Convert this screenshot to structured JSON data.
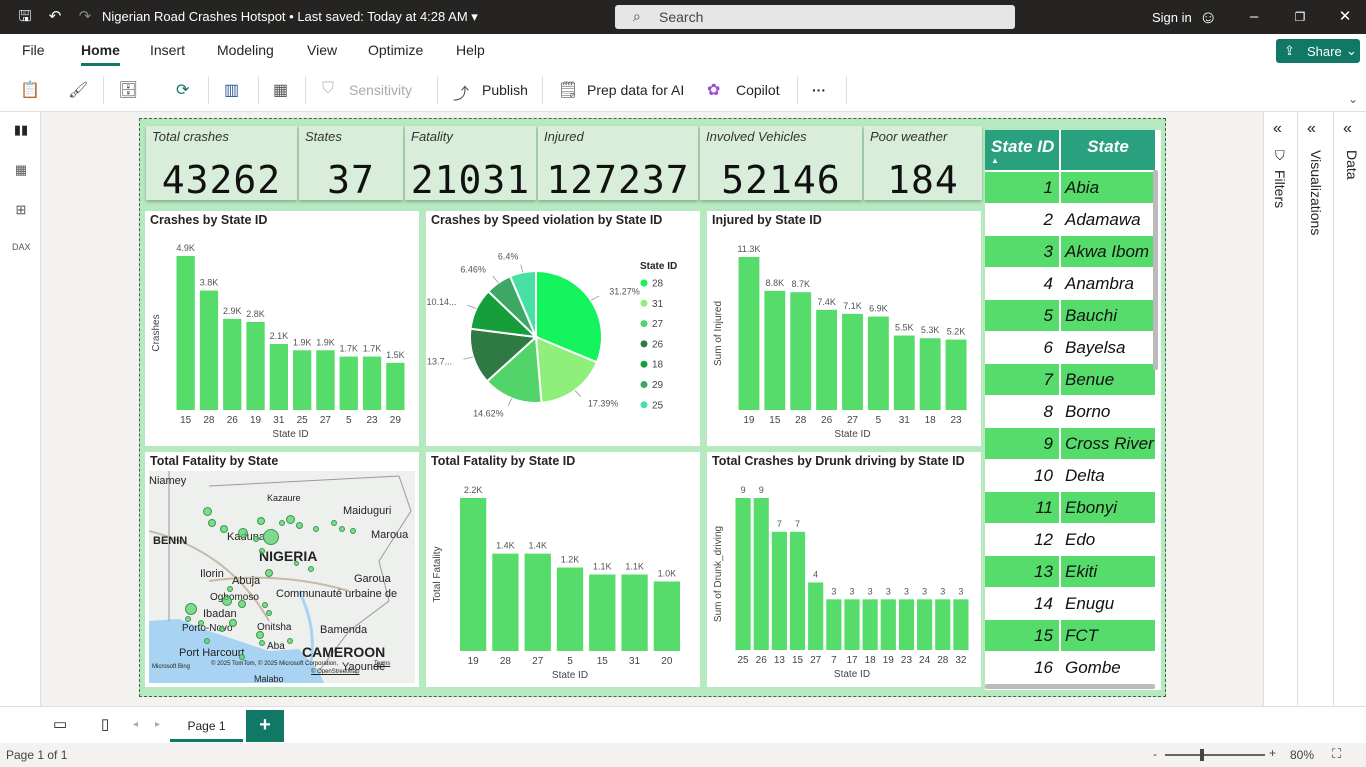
{
  "titlebar": {
    "doc_title": "Nigerian Road Crashes Hotspot",
    "saved": "Last saved: Today at 4:28 AM",
    "search_placeholder": "Search",
    "signin": "Sign in"
  },
  "menu": [
    "File",
    "Home",
    "Insert",
    "Modeling",
    "View",
    "Optimize",
    "Help"
  ],
  "share_label": "Share",
  "ribbon": {
    "sensitivity": "Sensitivity",
    "publish": "Publish",
    "prep": "Prep data for AI",
    "copilot": "Copilot",
    "more": "···"
  },
  "cards": [
    {
      "label": "Total crashes",
      "value": "43262"
    },
    {
      "label": "States",
      "value": "37"
    },
    {
      "label": "Fatality",
      "value": "21031"
    },
    {
      "label": "Injured",
      "value": "127237"
    },
    {
      "label": "Involved Vehicles",
      "value": "52146"
    },
    {
      "label": "Poor weather",
      "value": "184"
    }
  ],
  "charts": {
    "crashes_by_state": {
      "title": "Crashes by State ID",
      "ylabel": "Crashes",
      "xlabel": "State ID"
    },
    "pie": {
      "title": "Crashes by Speed violation by State ID",
      "legend_title": "State ID"
    },
    "injured": {
      "title": "Injured by State ID",
      "ylabel": "Sum of Injured",
      "xlabel": "State ID"
    },
    "map": {
      "title": "Total Fatality by State"
    },
    "fatality": {
      "title": "Total Fatality by State ID",
      "ylabel": "Total Fatality",
      "xlabel": "State ID"
    },
    "drunk": {
      "title": "Total Crashes by Drunk driving by State ID",
      "ylabel": "Sum of Drunk_driving",
      "xlabel": "State ID"
    }
  },
  "chart_data": [
    {
      "type": "bar",
      "title": "Crashes by State ID",
      "xlabel": "State ID",
      "ylabel": "Crashes",
      "categories": [
        "15",
        "28",
        "26",
        "19",
        "31",
        "25",
        "27",
        "5",
        "23",
        "29"
      ],
      "values": [
        4900,
        3800,
        2900,
        2800,
        2100,
        1900,
        1900,
        1700,
        1700,
        1500
      ],
      "labels": [
        "4.9K",
        "3.8K",
        "2.9K",
        "2.8K",
        "2.1K",
        "1.9K",
        "1.9K",
        "1.7K",
        "1.7K",
        "1.5K"
      ],
      "color": "#56dc6a"
    },
    {
      "type": "pie",
      "title": "Crashes by Speed violation by State ID",
      "categories": [
        "28",
        "31",
        "27",
        "26",
        "18",
        "29",
        "25"
      ],
      "values": [
        31.27,
        17.39,
        14.62,
        13.7,
        10.14,
        6.46,
        6.4
      ],
      "labels": [
        "31.27%",
        "17.39%",
        "14.62%",
        "13.7...",
        "10.14...",
        "6.46%",
        "6.4%"
      ],
      "colors": [
        "#12f35c",
        "#8ef07a",
        "#52d46a",
        "#2e7a42",
        "#159e3a",
        "#3da766",
        "#46e0a4"
      ]
    },
    {
      "type": "bar",
      "title": "Injured by State ID",
      "xlabel": "State ID",
      "ylabel": "Sum of Injured",
      "categories": [
        "19",
        "15",
        "28",
        "26",
        "27",
        "5",
        "31",
        "18",
        "23"
      ],
      "values": [
        11300,
        8800,
        8700,
        7400,
        7100,
        6900,
        5500,
        5300,
        5200
      ],
      "labels": [
        "11.3K",
        "8.8K",
        "8.7K",
        "7.4K",
        "7.1K",
        "6.9K",
        "5.5K",
        "5.3K",
        "5.2K"
      ],
      "color": "#56dc6a"
    },
    {
      "type": "bar",
      "title": "Total Fatality by State ID",
      "xlabel": "State ID",
      "ylabel": "Total Fatality",
      "categories": [
        "19",
        "28",
        "27",
        "5",
        "15",
        "31",
        "20"
      ],
      "values": [
        2200,
        1400,
        1400,
        1200,
        1100,
        1100,
        1000
      ],
      "labels": [
        "2.2K",
        "1.4K",
        "1.4K",
        "1.2K",
        "1.1K",
        "1.1K",
        "1.0K"
      ],
      "color": "#56dc6a"
    },
    {
      "type": "bar",
      "title": "Total Crashes by Drunk driving by State ID",
      "xlabel": "State ID",
      "ylabel": "Sum of Drunk_driving",
      "categories": [
        "25",
        "26",
        "13",
        "15",
        "27",
        "7",
        "17",
        "18",
        "19",
        "23",
        "24",
        "28",
        "32"
      ],
      "values": [
        9,
        9,
        7,
        7,
        4,
        3,
        3,
        3,
        3,
        3,
        3,
        3,
        3
      ],
      "labels": [
        "9",
        "9",
        "7",
        "7",
        "4",
        "3",
        "3",
        "3",
        "3",
        "3",
        "3",
        "3",
        "3"
      ],
      "color": "#56dc6a"
    }
  ],
  "map": {
    "labels": [
      "Niamey",
      "Kazaure",
      "Maiduguri",
      "BENIN",
      "Kaduna",
      "NIGERIA",
      "Maroua",
      "Ilorin",
      "Abuja",
      "Garoua",
      "Ogbomoso",
      "Communauté urbaine de",
      "Ibadan",
      "Porto-Novo",
      "Onitsha",
      "Bamenda",
      "CAMEROON",
      "Port Harcourt",
      "Aba",
      "Yaoundé",
      "Malabo"
    ],
    "credit": "© 2025 TomTom, © 2025 Microsoft Corporation,",
    "terms": "Terms",
    "osm": "© OpenStreetMap",
    "bing": "Microsoft Bing"
  },
  "table": {
    "headers": [
      "State ID",
      "State"
    ],
    "rows": [
      [
        "1",
        "Abia"
      ],
      [
        "2",
        "Adamawa"
      ],
      [
        "3",
        "Akwa Ibom"
      ],
      [
        "4",
        "Anambra"
      ],
      [
        "5",
        "Bauchi"
      ],
      [
        "6",
        "Bayelsa"
      ],
      [
        "7",
        "Benue"
      ],
      [
        "8",
        "Borno"
      ],
      [
        "9",
        "Cross River"
      ],
      [
        "10",
        "Delta"
      ],
      [
        "11",
        "Ebonyi"
      ],
      [
        "12",
        "Edo"
      ],
      [
        "13",
        "Ekiti"
      ],
      [
        "14",
        "Enugu"
      ],
      [
        "15",
        "FCT"
      ],
      [
        "16",
        "Gombe"
      ]
    ],
    "row_colors": [
      "#56dc6a",
      "#ffffff"
    ]
  },
  "panes": {
    "filters": "Filters",
    "visualizations": "Visualizations",
    "data": "Data"
  },
  "bottom": {
    "page_tab": "Page 1",
    "add": "+"
  },
  "status": {
    "page": "Page 1 of 1",
    "zoom": "80%"
  }
}
